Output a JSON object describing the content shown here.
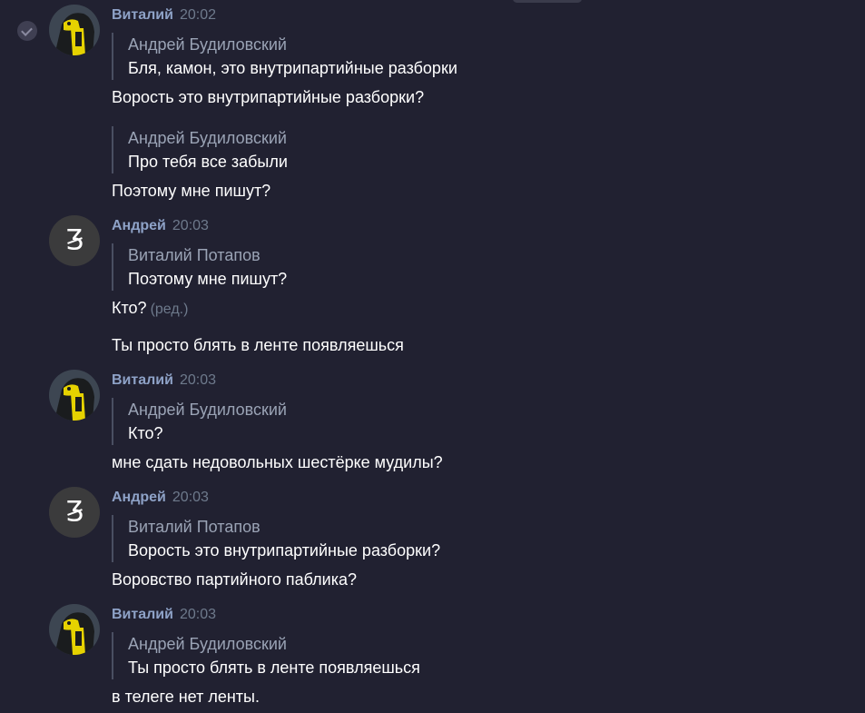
{
  "groups": [
    {
      "sender": "Виталий",
      "time": "20:02",
      "messages": [
        {
          "quote_author": "Андрей Будиловский",
          "quote_text": "Бля, камон, это внутрипартийные разборки",
          "text": "Ворость это внутрипартийные разборки?"
        },
        {
          "quote_author": "Андрей Будиловский",
          "quote_text": "Про тебя все забыли",
          "text": "Поэтому мне пишут?"
        }
      ]
    },
    {
      "sender": "Андрей",
      "time": "20:03",
      "messages": [
        {
          "quote_author": "Виталий Потапов",
          "quote_text": "Поэтому мне пишут?",
          "text": "Кто?",
          "edited": "(ред.)"
        },
        {
          "text": "Ты просто блять в ленте появляешься"
        }
      ]
    },
    {
      "sender": "Виталий",
      "time": "20:03",
      "messages": [
        {
          "quote_author": "Андрей Будиловский",
          "quote_text": "Кто?",
          "text": "мне сдать недовольных шестёрке мудилы?"
        }
      ]
    },
    {
      "sender": "Андрей",
      "time": "20:03",
      "messages": [
        {
          "quote_author": "Виталий Потапов",
          "quote_text": "Ворость это внутрипартийные разборки?",
          "text": "Воровство партийного паблика?"
        }
      ]
    },
    {
      "sender": "Виталий",
      "time": "20:03",
      "messages": [
        {
          "quote_author": "Андрей Будиловский",
          "quote_text": "Ты просто блять в ленте появляешься",
          "text": "в телеге нет ленты."
        }
      ]
    }
  ],
  "avatars": {
    "andrey_glyph": "Ʒ"
  },
  "icons": {
    "check": "check-icon"
  },
  "colors": {
    "background": "#212131",
    "sender": "#8ea2c7",
    "time": "#6e7a8c",
    "quote_author": "#9aa3b5",
    "quote_bar": "#4a4f62"
  }
}
